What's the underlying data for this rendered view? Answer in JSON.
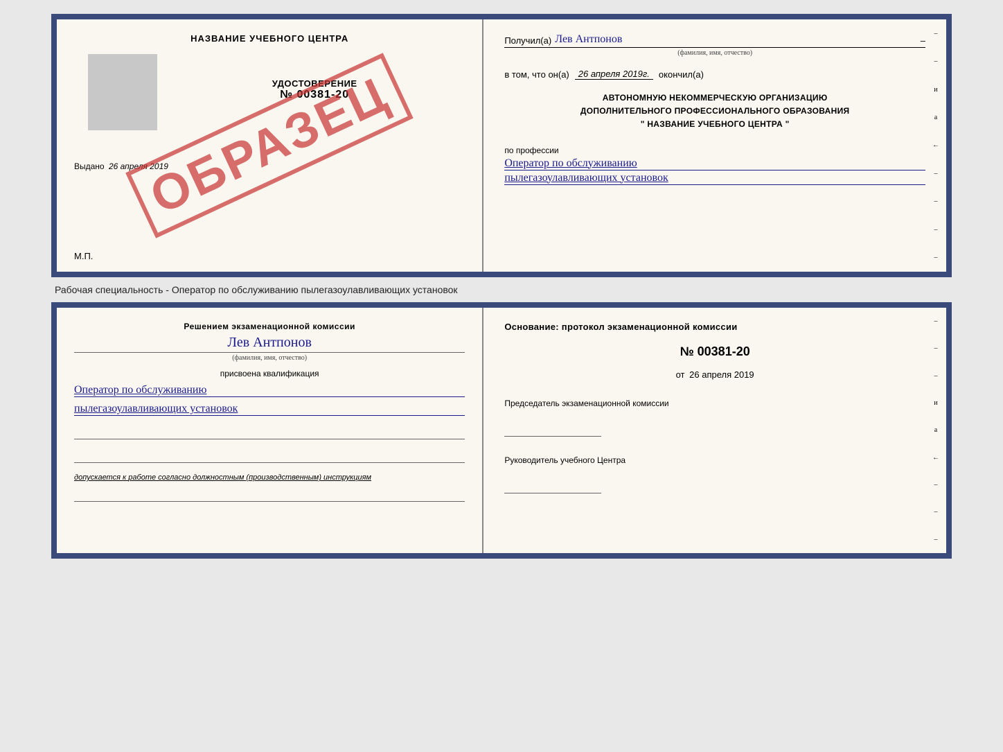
{
  "doc_top": {
    "left": {
      "title": "НАЗВАНИЕ УЧЕБНОГО ЦЕНТРА",
      "stamp": "ОБРАЗЕЦ",
      "udostoverenie_label": "УДОСТОВЕРЕНИЕ",
      "number": "№ 00381-20",
      "vydano": "Выдано",
      "vydano_date": "26 апреля 2019",
      "mp": "М.П."
    },
    "right": {
      "poluchil_label": "Получил(а)",
      "poluchil_name": "Лев Антпонов",
      "fio_sub": "(фамилия, имя, отчество)",
      "vtom_label": "в том, что он(а)",
      "vtom_date": "26 апреля 2019г.",
      "okonchil_label": "окончил(а)",
      "org_line1": "АВТОНОМНУЮ НЕКОММЕРЧЕСКУЮ ОРГАНИЗАЦИЮ",
      "org_line2": "ДОПОЛНИТЕЛЬНОГО ПРОФЕССИОНАЛЬНОГО ОБРАЗОВАНИЯ",
      "org_line3": "\"  НАЗВАНИЕ УЧЕБНОГО ЦЕНТРА  \"",
      "profession_label": "по профессии",
      "profession_line1": "Оператор по обслуживанию",
      "profession_line2": "пылегазоулавливающих установок"
    }
  },
  "separator": {
    "text": "Рабочая специальность - Оператор по обслуживанию пылегазоулавливающих установок"
  },
  "doc_bottom": {
    "left": {
      "resheniem_text": "Решением экзаменационной комиссии",
      "person_name": "Лев Антпонов",
      "fio_sub": "(фамилия, имя, отчество)",
      "prisvoena_text": "присвоена квалификация",
      "kvalif_line1": "Оператор по обслуживанию",
      "kvalif_line2": "пылегазоулавливающих установок",
      "dopuskaetsya_prefix": "допускается к ",
      "dopuskaetsya_rest": "работе согласно должностным (производственным) инструкциям"
    },
    "right": {
      "osnovanie_label": "Основание: протокол экзаменационной комиссии",
      "protocol_number": "№  00381-20",
      "ot_label": "от",
      "ot_date": "26 апреля 2019",
      "chairman_label": "Председатель экзаменационной комиссии",
      "rukovoditel_label": "Руководитель учебного Центра"
    }
  },
  "side_dashes": [
    "-",
    "и",
    "а",
    "←",
    "-",
    "-",
    "-",
    "-"
  ],
  "side_dashes2": [
    "-",
    "-",
    "-",
    "и",
    "а",
    "←",
    "-",
    "-",
    "-"
  ]
}
